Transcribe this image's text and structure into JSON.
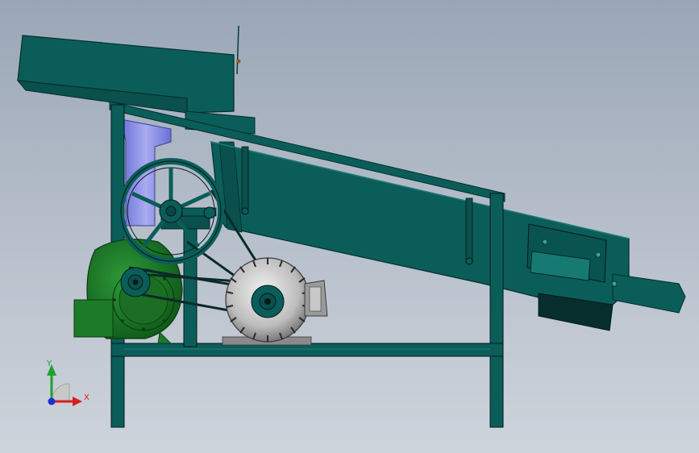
{
  "colors": {
    "background_top": "#9aa6b6",
    "background_bottom": "#ced4dc",
    "machine_body": "#0b5d5a",
    "machine_dark": "#063f3c",
    "machine_light": "#1f7a74",
    "blower_green": "#1f7a2a",
    "chute_purple": "#8b8ee6",
    "motor_gray": "#c8c8c8",
    "axis_x": "#d42020",
    "axis_y": "#20a030",
    "axis_z": "#2030d0"
  },
  "triad": {
    "x_label": "X",
    "y_label": "Y"
  }
}
